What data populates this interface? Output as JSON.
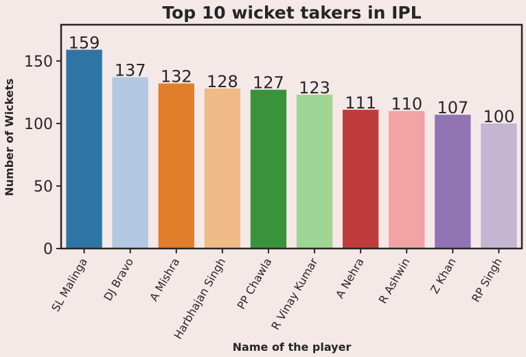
{
  "chart_data": {
    "type": "bar",
    "title": "Top 10 wicket takers in IPL",
    "xlabel": "Name of the player",
    "ylabel": "Number of Wickets",
    "categories": [
      "SL Malinga",
      "DJ Bravo",
      "A Mishra",
      "Harbhajan Singh",
      "PP Chawla",
      "R Vinay Kumar",
      "A Nehra",
      "R Ashwin",
      "Z Khan",
      "RP Singh"
    ],
    "values": [
      159,
      137,
      132,
      128,
      127,
      123,
      111,
      110,
      107,
      100
    ],
    "colors": [
      "#2e75a6",
      "#b2c8e3",
      "#e07e2c",
      "#efba88",
      "#3a933a",
      "#9fd595",
      "#bf3c3c",
      "#f2a3a3",
      "#9273b3",
      "#c4b6d2"
    ],
    "yticks": [
      0,
      50,
      100,
      150
    ],
    "ylim": [
      0,
      179
    ],
    "grid": false,
    "background": "#f5e9e8",
    "axis_color": "#262626"
  }
}
